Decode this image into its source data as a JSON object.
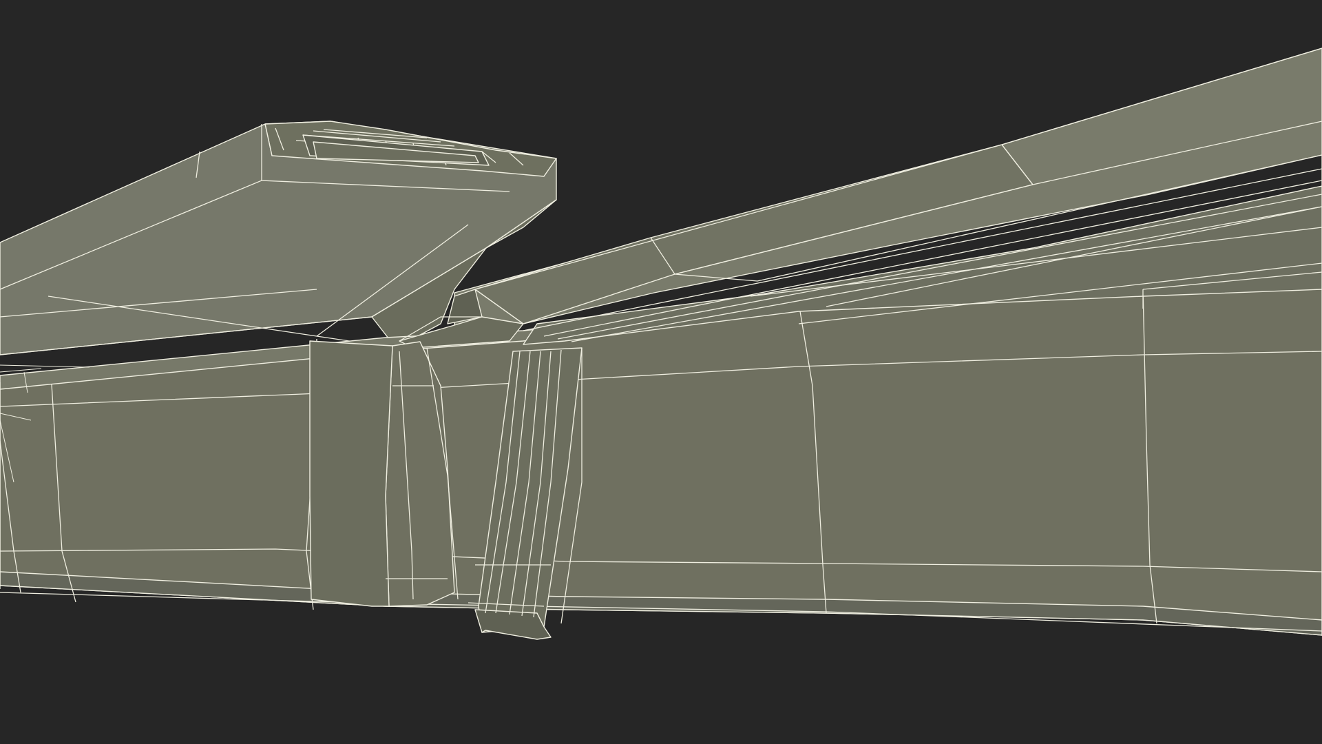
{
  "scene": {
    "colors": {
      "background": "#262626",
      "surface": "#6f7060",
      "surface_top": "#76786a",
      "surface_shadow": "#5f6153",
      "wireframe": "#efeee0"
    }
  }
}
